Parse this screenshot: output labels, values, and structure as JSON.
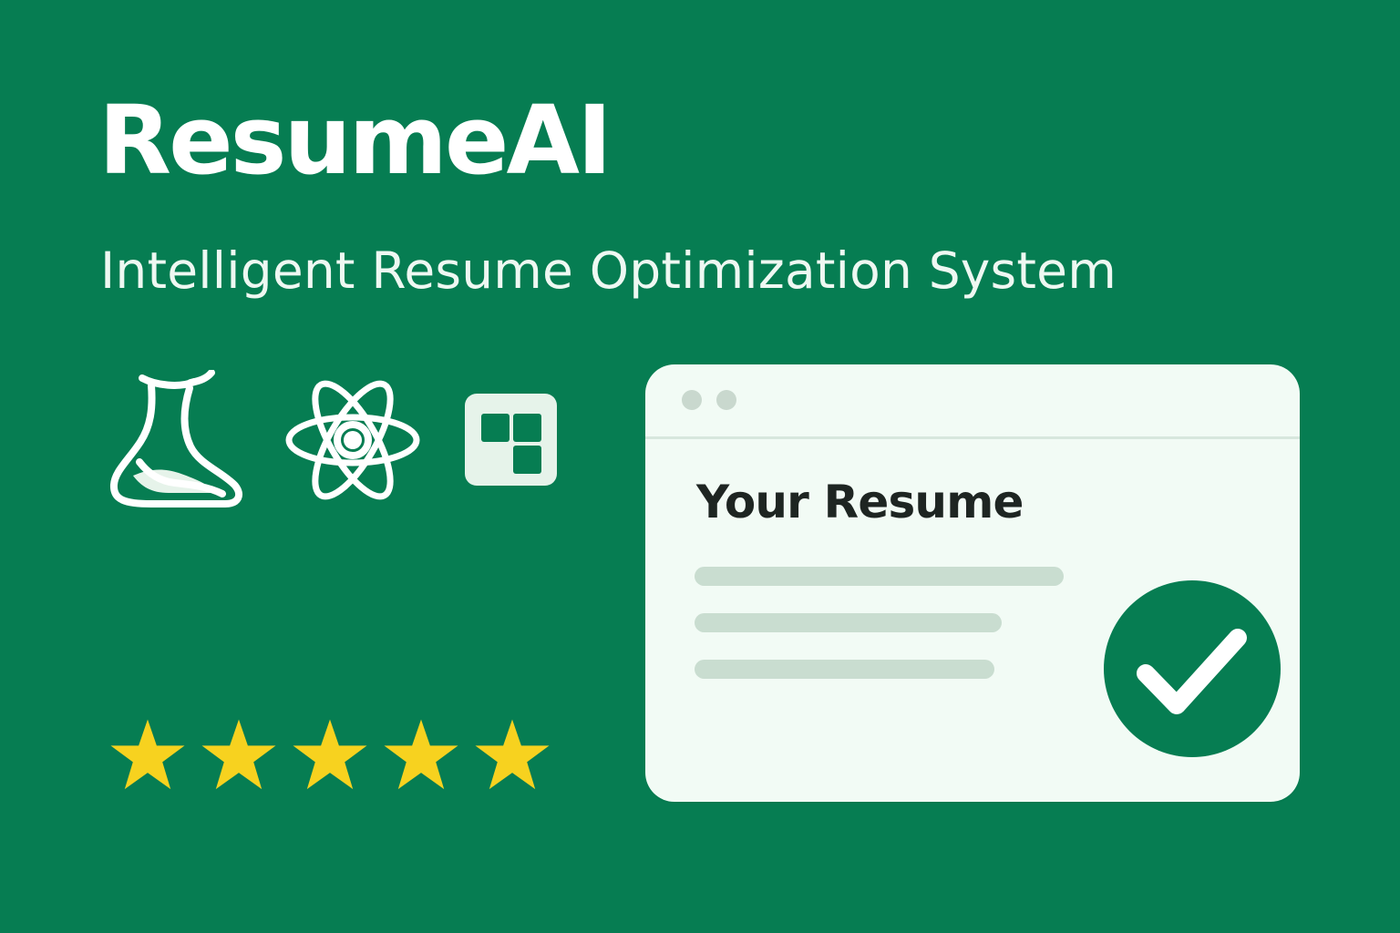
{
  "brand": {
    "name": "ResumeAI",
    "tagline": "Intelligent Resume Optimization System"
  },
  "tech_icons": [
    {
      "icon": "flask-icon"
    },
    {
      "icon": "atom-icon"
    },
    {
      "icon": "grid-blocks-icon"
    }
  ],
  "rating": {
    "stars": 5,
    "max": 5
  },
  "resume_card": {
    "title": "Your Resume",
    "status_icon": "check-circle-icon"
  },
  "colors": {
    "background": "#067d52",
    "card": "#f2fbf5",
    "icon": "#ffffff",
    "icon_light": "#e6f3ea",
    "star": "#f7d21f",
    "check_circle": "#067d52",
    "placeholder_line": "#c9ddd0"
  }
}
